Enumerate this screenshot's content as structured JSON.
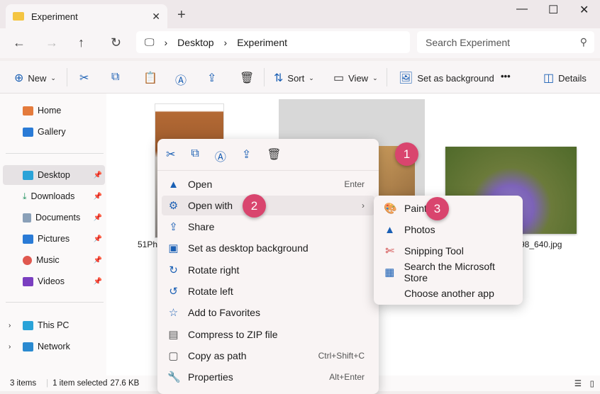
{
  "window": {
    "tab_title": "Experiment"
  },
  "address": {
    "segments": [
      "Desktop",
      "Experiment"
    ],
    "search_placeholder": "Search Experiment"
  },
  "toolbar": {
    "new": "New",
    "sort": "Sort",
    "view": "View",
    "set_bg": "Set as background",
    "more": "•••",
    "details": "Details"
  },
  "sidebar": {
    "items": [
      {
        "label": "Home"
      },
      {
        "label": "Gallery"
      },
      {
        "label": "Desktop"
      },
      {
        "label": "Downloads"
      },
      {
        "label": "Documents"
      },
      {
        "label": "Pictures"
      },
      {
        "label": "Music"
      },
      {
        "label": "Videos"
      },
      {
        "label": "This PC"
      },
      {
        "label": "Network"
      }
    ]
  },
  "files": [
    {
      "name": "51PhV"
    },
    {
      "name": ""
    },
    {
      "name": "98_640.jpg"
    }
  ],
  "context_menu": {
    "items": [
      {
        "label": "Open",
        "shortcut": "Enter"
      },
      {
        "label": "Open with"
      },
      {
        "label": "Share"
      },
      {
        "label": "Set as desktop background"
      },
      {
        "label": "Rotate right"
      },
      {
        "label": "Rotate left"
      },
      {
        "label": "Add to Favorites"
      },
      {
        "label": "Compress to ZIP file"
      },
      {
        "label": "Copy as path",
        "shortcut": "Ctrl+Shift+C"
      },
      {
        "label": "Properties",
        "shortcut": "Alt+Enter"
      }
    ]
  },
  "submenu": {
    "items": [
      {
        "label": "Paint"
      },
      {
        "label": "Photos"
      },
      {
        "label": "Snipping Tool"
      },
      {
        "label": "Search the Microsoft Store"
      },
      {
        "label": "Choose another app"
      }
    ]
  },
  "badges": [
    "1",
    "2",
    "3"
  ],
  "status": {
    "count": "3 items",
    "selected": "1 item selected",
    "size": "27.6 KB"
  }
}
